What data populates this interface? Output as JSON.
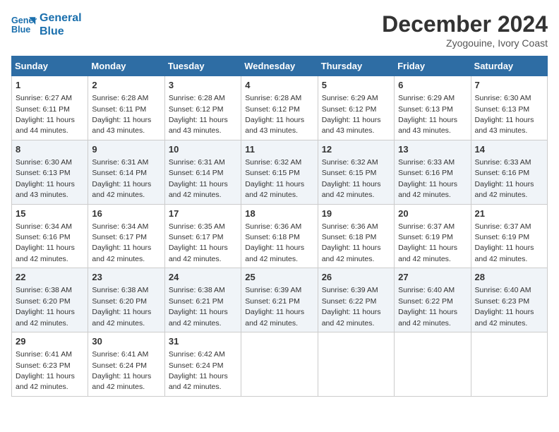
{
  "header": {
    "logo_line1": "General",
    "logo_line2": "Blue",
    "month_title": "December 2024",
    "subtitle": "Zyogouine, Ivory Coast"
  },
  "weekdays": [
    "Sunday",
    "Monday",
    "Tuesday",
    "Wednesday",
    "Thursday",
    "Friday",
    "Saturday"
  ],
  "weeks": [
    [
      {
        "day": "1",
        "sunrise": "6:27 AM",
        "sunset": "6:11 PM",
        "daylight": "11 hours and 44 minutes."
      },
      {
        "day": "2",
        "sunrise": "6:28 AM",
        "sunset": "6:11 PM",
        "daylight": "11 hours and 43 minutes."
      },
      {
        "day": "3",
        "sunrise": "6:28 AM",
        "sunset": "6:12 PM",
        "daylight": "11 hours and 43 minutes."
      },
      {
        "day": "4",
        "sunrise": "6:28 AM",
        "sunset": "6:12 PM",
        "daylight": "11 hours and 43 minutes."
      },
      {
        "day": "5",
        "sunrise": "6:29 AM",
        "sunset": "6:12 PM",
        "daylight": "11 hours and 43 minutes."
      },
      {
        "day": "6",
        "sunrise": "6:29 AM",
        "sunset": "6:13 PM",
        "daylight": "11 hours and 43 minutes."
      },
      {
        "day": "7",
        "sunrise": "6:30 AM",
        "sunset": "6:13 PM",
        "daylight": "11 hours and 43 minutes."
      }
    ],
    [
      {
        "day": "8",
        "sunrise": "6:30 AM",
        "sunset": "6:13 PM",
        "daylight": "11 hours and 43 minutes."
      },
      {
        "day": "9",
        "sunrise": "6:31 AM",
        "sunset": "6:14 PM",
        "daylight": "11 hours and 42 minutes."
      },
      {
        "day": "10",
        "sunrise": "6:31 AM",
        "sunset": "6:14 PM",
        "daylight": "11 hours and 42 minutes."
      },
      {
        "day": "11",
        "sunrise": "6:32 AM",
        "sunset": "6:15 PM",
        "daylight": "11 hours and 42 minutes."
      },
      {
        "day": "12",
        "sunrise": "6:32 AM",
        "sunset": "6:15 PM",
        "daylight": "11 hours and 42 minutes."
      },
      {
        "day": "13",
        "sunrise": "6:33 AM",
        "sunset": "6:16 PM",
        "daylight": "11 hours and 42 minutes."
      },
      {
        "day": "14",
        "sunrise": "6:33 AM",
        "sunset": "6:16 PM",
        "daylight": "11 hours and 42 minutes."
      }
    ],
    [
      {
        "day": "15",
        "sunrise": "6:34 AM",
        "sunset": "6:16 PM",
        "daylight": "11 hours and 42 minutes."
      },
      {
        "day": "16",
        "sunrise": "6:34 AM",
        "sunset": "6:17 PM",
        "daylight": "11 hours and 42 minutes."
      },
      {
        "day": "17",
        "sunrise": "6:35 AM",
        "sunset": "6:17 PM",
        "daylight": "11 hours and 42 minutes."
      },
      {
        "day": "18",
        "sunrise": "6:36 AM",
        "sunset": "6:18 PM",
        "daylight": "11 hours and 42 minutes."
      },
      {
        "day": "19",
        "sunrise": "6:36 AM",
        "sunset": "6:18 PM",
        "daylight": "11 hours and 42 minutes."
      },
      {
        "day": "20",
        "sunrise": "6:37 AM",
        "sunset": "6:19 PM",
        "daylight": "11 hours and 42 minutes."
      },
      {
        "day": "21",
        "sunrise": "6:37 AM",
        "sunset": "6:19 PM",
        "daylight": "11 hours and 42 minutes."
      }
    ],
    [
      {
        "day": "22",
        "sunrise": "6:38 AM",
        "sunset": "6:20 PM",
        "daylight": "11 hours and 42 minutes."
      },
      {
        "day": "23",
        "sunrise": "6:38 AM",
        "sunset": "6:20 PM",
        "daylight": "11 hours and 42 minutes."
      },
      {
        "day": "24",
        "sunrise": "6:38 AM",
        "sunset": "6:21 PM",
        "daylight": "11 hours and 42 minutes."
      },
      {
        "day": "25",
        "sunrise": "6:39 AM",
        "sunset": "6:21 PM",
        "daylight": "11 hours and 42 minutes."
      },
      {
        "day": "26",
        "sunrise": "6:39 AM",
        "sunset": "6:22 PM",
        "daylight": "11 hours and 42 minutes."
      },
      {
        "day": "27",
        "sunrise": "6:40 AM",
        "sunset": "6:22 PM",
        "daylight": "11 hours and 42 minutes."
      },
      {
        "day": "28",
        "sunrise": "6:40 AM",
        "sunset": "6:23 PM",
        "daylight": "11 hours and 42 minutes."
      }
    ],
    [
      {
        "day": "29",
        "sunrise": "6:41 AM",
        "sunset": "6:23 PM",
        "daylight": "11 hours and 42 minutes."
      },
      {
        "day": "30",
        "sunrise": "6:41 AM",
        "sunset": "6:24 PM",
        "daylight": "11 hours and 42 minutes."
      },
      {
        "day": "31",
        "sunrise": "6:42 AM",
        "sunset": "6:24 PM",
        "daylight": "11 hours and 42 minutes."
      },
      null,
      null,
      null,
      null
    ]
  ]
}
